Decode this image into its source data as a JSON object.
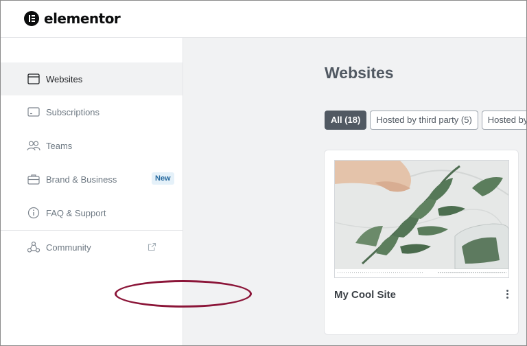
{
  "brand": {
    "name": "elementor"
  },
  "sidebar": {
    "items": [
      {
        "label": "Websites",
        "icon": "browser-window-icon",
        "active": true
      },
      {
        "label": "Subscriptions",
        "icon": "subscription-card-icon"
      },
      {
        "label": "Teams",
        "icon": "users-icon"
      },
      {
        "label": "Brand & Business",
        "icon": "briefcase-icon",
        "badge": "New"
      },
      {
        "label": "FAQ & Support",
        "icon": "info-circle-icon"
      },
      {
        "label": "Community",
        "icon": "community-icon",
        "trailing_icon": "external-link-icon"
      }
    ]
  },
  "main": {
    "title": "Websites",
    "filters": [
      {
        "label": "All (18)",
        "active": true
      },
      {
        "label": "Hosted by third party (5)"
      },
      {
        "label": "Hosted by El"
      }
    ],
    "sites": [
      {
        "name": "My Cool Site"
      }
    ]
  },
  "colors": {
    "highlight_ring": "#8b1538",
    "active_chip": "#515962",
    "badge_bg": "#e5f1f9",
    "badge_text": "#2a6ca0"
  }
}
